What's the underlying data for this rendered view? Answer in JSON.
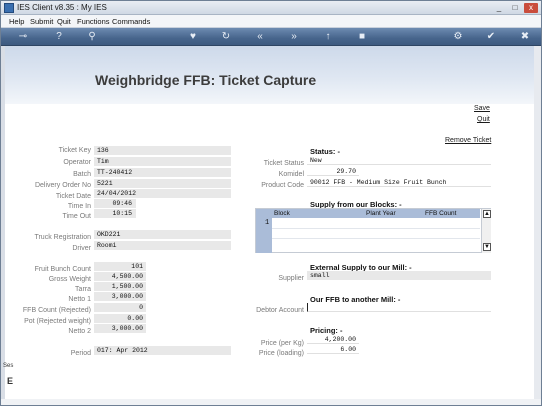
{
  "window": {
    "title": "IES Client v8.35 : My IES",
    "controls": [
      "_",
      "□",
      "x"
    ]
  },
  "menu": {
    "items": [
      "Help",
      "Submit",
      "Quit",
      "Functions",
      "Commands"
    ]
  },
  "toolbar": {
    "icons": [
      "key-icon",
      "help-icon",
      "search-icon",
      "heart-icon",
      "refresh-icon",
      "rewind-icon",
      "forward-icon",
      "up-icon",
      "stop-icon",
      "gear-icon",
      "check-icon",
      "close-icon"
    ],
    "glyphs": [
      "⊸",
      "?",
      "⚲",
      "♥",
      "↻",
      "«",
      "»",
      "↑",
      "■",
      "⚙",
      "✔",
      "✖"
    ]
  },
  "page": {
    "heading": "Weighbridge FFB: Ticket Capture",
    "save": "Save",
    "quit": "Quit",
    "remove_ticket": "Remove Ticket"
  },
  "left": {
    "ticket_key": {
      "label": "Ticket Key",
      "value": "136"
    },
    "operator": {
      "label": "Operator",
      "value": "Tim"
    },
    "batch": {
      "label": "Batch",
      "value": "TT-240412"
    },
    "delivery_order_no": {
      "label": "Delivery Order No",
      "value": "5221"
    },
    "ticket_date": {
      "label": "Ticket Date",
      "value": "24/04/2012"
    },
    "time_in": {
      "label": "Time In",
      "value": "09:46"
    },
    "time_out": {
      "label": "Time Out",
      "value": "10:15"
    },
    "truck_registration": {
      "label": "Truck Registration",
      "value": "OKD221"
    },
    "driver": {
      "label": "Driver",
      "value": "Roomi"
    },
    "fruit_bunch_count": {
      "label": "Fruit Bunch Count",
      "value": "101"
    },
    "gross_weight": {
      "label": "Gross Weight",
      "value": "4,500.00"
    },
    "tarra": {
      "label": "Tarra",
      "value": "1,500.00"
    },
    "netto_1": {
      "label": "Netto 1",
      "value": "3,000.00"
    },
    "ffb_count_rejected": {
      "label": "FFB Count (Rejected)",
      "value": "0"
    },
    "pot_rejected_weight": {
      "label": "Pot (Rejected weight)",
      "value": "0.00"
    },
    "netto_2": {
      "label": "Netto 2",
      "value": "3,000.00"
    },
    "period": {
      "label": "Period",
      "value": "017: Apr 2012"
    }
  },
  "right": {
    "status_heading": "Status: -",
    "ticket_status": {
      "label": "Ticket Status",
      "value": "New"
    },
    "komidel": {
      "label": "Komidel",
      "value": "29.70"
    },
    "product_code": {
      "label": "Product Code",
      "value": "90012 FFB - Medium Size Fruit Bunch"
    },
    "blocks_heading": "Supply from our Blocks: -",
    "blocks_grid": {
      "columns": [
        "Block",
        "Plant Year",
        "FFB Count"
      ],
      "row_numbers": [
        "1"
      ]
    },
    "external_heading": "External Supply to our Mill: -",
    "supplier": {
      "label": "Supplier",
      "value": "small"
    },
    "ffb_another_heading": "Our FFB to another Mill: -",
    "debtor_account": {
      "label": "Debtor Account",
      "value": ""
    },
    "pricing_heading": "Pricing: -",
    "price_per_kg": {
      "label": "Price (per Kg)",
      "value": "4,200.00"
    },
    "price_loading": {
      "label": "Price (loading)",
      "value": "6.00"
    }
  },
  "footer": {
    "side_label": "Ses",
    "side_glyph": "E"
  }
}
